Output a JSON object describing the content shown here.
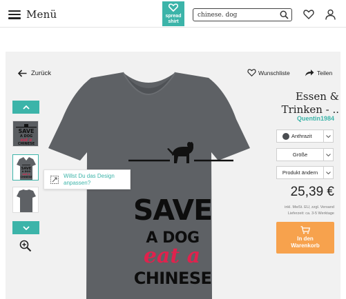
{
  "header": {
    "menu_label": "Menü",
    "logo_line1": "spread",
    "logo_line2": "shirt",
    "search_value": "chinese. dog",
    "icons": [
      "menu-icon",
      "search-icon",
      "heart-icon",
      "user-icon"
    ]
  },
  "product": {
    "back_label": "Zurück",
    "wishlist_label": "Wunschliste",
    "share_label": "Teilen",
    "title_line1": "Essen &",
    "title_line2": "Trinken - ..",
    "author": "Quentin1984",
    "color": {
      "label": "Anthrazit",
      "swatch": "#4a4d51"
    },
    "size_label": "Größe",
    "change_product_label": "Produkt ändern",
    "price": "25,39 €",
    "vat_line1": "inkl. MwSt. EU, zzgl. Versand",
    "vat_line2": "Lieferzeit: ca. 3-5 Werktage",
    "cart_line1": "In den",
    "cart_line2": "Warenkorb",
    "tooltip_line1": "Willst Du das Design",
    "tooltip_line2": "anpassen?"
  },
  "design": {
    "line1": "SAVE",
    "line2": "A DOG",
    "line3": "eat a",
    "line4": "CHINESE"
  },
  "thumbnails": {
    "t1": {
      "line1": "SAVE",
      "line2": "A DOG",
      "line3": "eat a",
      "line4": "CHINESE"
    },
    "t2": {
      "line1": "SAVE",
      "line2": "A DOG",
      "line3": "eat a",
      "line4": "CHINESE"
    }
  },
  "colors": {
    "accent": "#3cb4a9",
    "cart": "#f7a24d",
    "shirt": "#5e6165",
    "design_red": "#e0224d"
  }
}
